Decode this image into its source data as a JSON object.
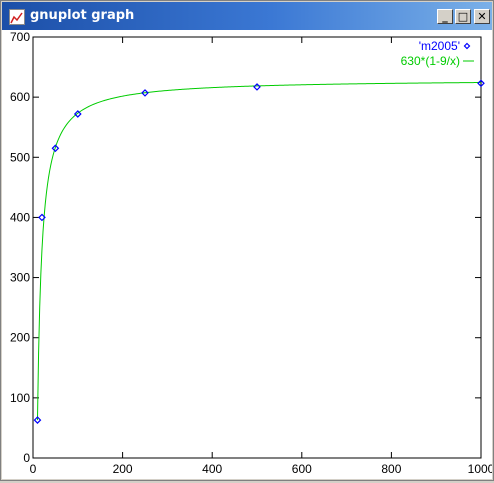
{
  "window": {
    "title": "gnuplot graph",
    "minimize_glyph": "_",
    "maximize_glyph": "□",
    "close_glyph": "✕"
  },
  "icons": {
    "app": "gnuplot-app-icon",
    "minimize": "minimize-icon",
    "maximize": "maximize-icon",
    "close": "close-icon"
  },
  "chart_data": {
    "type": "scatter",
    "xlim": [
      0,
      1000
    ],
    "ylim": [
      0,
      700
    ],
    "x_ticks": [
      0,
      200,
      400,
      600,
      800,
      1000
    ],
    "y_ticks": [
      0,
      100,
      200,
      300,
      400,
      500,
      600,
      700
    ],
    "grid": false,
    "legend_position": "top-right",
    "series": [
      {
        "name": "'m2005'",
        "kind": "points",
        "color": "#0000ff",
        "x": [
          10,
          20,
          50,
          100,
          250,
          500,
          1000
        ],
        "y": [
          63,
          400,
          515,
          572,
          607,
          617,
          623
        ]
      },
      {
        "name": "630*(1-9/x)",
        "kind": "function",
        "color": "#00cc00",
        "x_from": 10,
        "x_to": 1000,
        "a": 630,
        "b": 9
      }
    ]
  }
}
